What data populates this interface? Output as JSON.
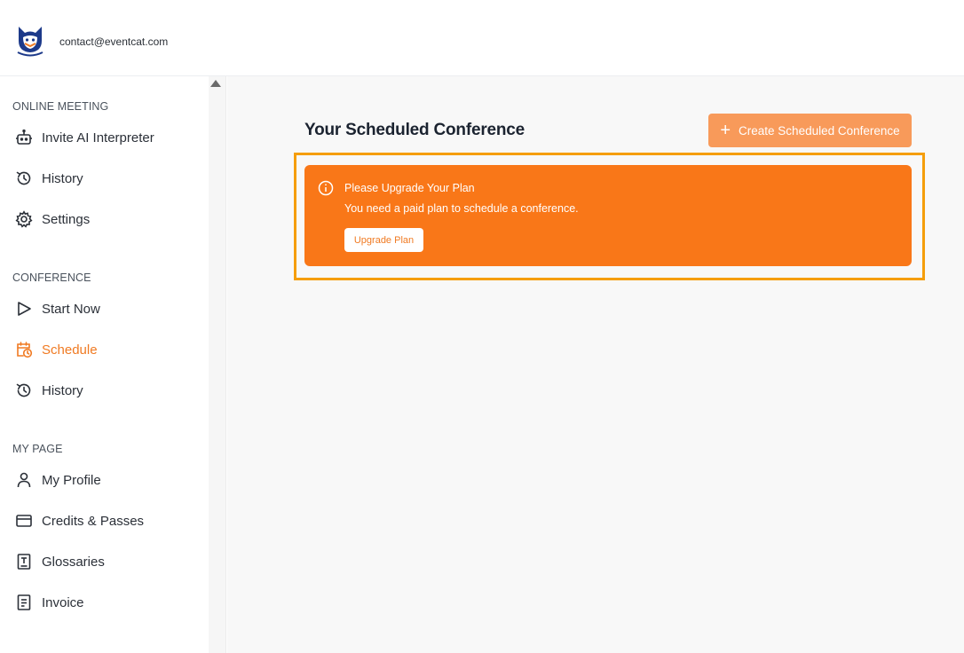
{
  "header": {
    "logo_icon": "cat-logo-icon",
    "email": "contact@eventcat.com"
  },
  "sidebar": {
    "sections": [
      {
        "title": "ONLINE MEETING",
        "items": [
          {
            "label": "Invite AI Interpreter",
            "icon": "robot-icon"
          },
          {
            "label": "History",
            "icon": "history-icon"
          },
          {
            "label": "Settings",
            "icon": "gear-icon"
          }
        ]
      },
      {
        "title": "CONFERENCE",
        "items": [
          {
            "label": "Start Now",
            "icon": "play-icon"
          },
          {
            "label": "Schedule",
            "icon": "calendar-clock-icon",
            "active": true
          },
          {
            "label": "History",
            "icon": "history-icon"
          }
        ]
      },
      {
        "title": "MY PAGE",
        "items": [
          {
            "label": "My Profile",
            "icon": "user-icon"
          },
          {
            "label": "Credits & Passes",
            "icon": "card-icon"
          },
          {
            "label": "Glossaries",
            "icon": "glossary-icon"
          },
          {
            "label": "Invoice",
            "icon": "invoice-icon"
          }
        ]
      }
    ]
  },
  "main": {
    "title": "Your Scheduled Conference",
    "create_button": "Create Scheduled Conference",
    "alert": {
      "title": "Please Upgrade Your Plan",
      "message": "You need a paid plan to schedule a conference.",
      "button": "Upgrade Plan"
    }
  },
  "colors": {
    "accent": "#f07a22",
    "alert_bg": "#f97718",
    "create_button_bg": "#f89a5a",
    "highlight": "#f59e0b",
    "main_bg": "#f8f8f8"
  }
}
